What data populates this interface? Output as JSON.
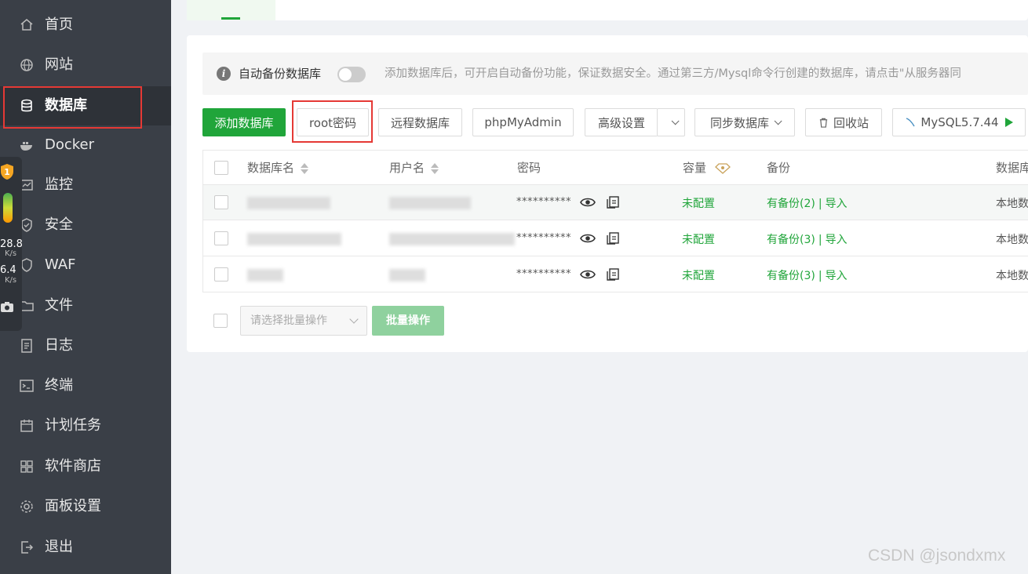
{
  "sidebar": {
    "items": [
      {
        "label": "首页"
      },
      {
        "label": "网站"
      },
      {
        "label": "数据库"
      },
      {
        "label": "Docker"
      },
      {
        "label": "监控"
      },
      {
        "label": "安全"
      },
      {
        "label": "WAF"
      },
      {
        "label": "文件"
      },
      {
        "label": "日志"
      },
      {
        "label": "终端"
      },
      {
        "label": "计划任务"
      },
      {
        "label": "软件商店"
      },
      {
        "label": "面板设置"
      },
      {
        "label": "退出"
      }
    ],
    "active_index": 2
  },
  "speed_widget": {
    "badge": "1",
    "up_value": "28.8",
    "up_unit": "K/s",
    "down_value": "6.4",
    "down_unit": "K/s"
  },
  "notice": {
    "title": "自动备份数据库",
    "description": "添加数据库后，可开启自动备份功能，保证数据安全。通过第三方/Mysql命令行创建的数据库，请点击\"从服务器同"
  },
  "toolbar": {
    "add_db": "添加数据库",
    "root_password": "root密码",
    "remote_db": "远程数据库",
    "phpmyadmin": "phpMyAdmin",
    "advanced": "高级设置",
    "sync_db": "同步数据库",
    "recycle": "回收站",
    "mysql_version": "MySQL5.7.44"
  },
  "table": {
    "headers": {
      "db_name": "数据库名",
      "username": "用户名",
      "password": "密码",
      "capacity": "容量",
      "backup": "备份",
      "location": "数据库"
    },
    "rows": [
      {
        "password": "**********",
        "capacity": "未配置",
        "backup": "有备份(2)",
        "import": "导入",
        "location": "本地数"
      },
      {
        "password": "**********",
        "capacity": "未配置",
        "backup": "有备份(3)",
        "import": "导入",
        "location": "本地数"
      },
      {
        "password": "**********",
        "capacity": "未配置",
        "backup": "有备份(3)",
        "import": "导入",
        "location": "本地数"
      }
    ]
  },
  "batch": {
    "select_placeholder": "请选择批量操作",
    "button": "批量操作"
  },
  "watermark": "CSDN @jsondxmx",
  "colors": {
    "sidebar_bg": "#3a3f47",
    "primary": "#20a53a",
    "highlight": "#e53935"
  }
}
